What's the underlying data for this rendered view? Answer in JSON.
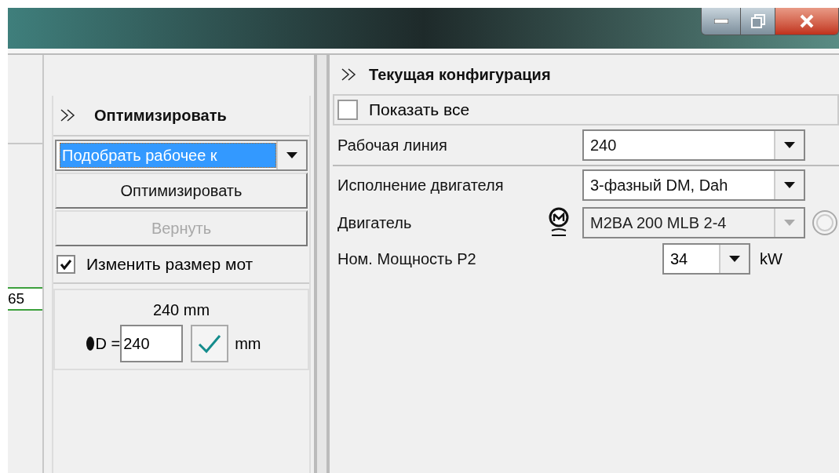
{
  "left_fragment": {
    "value": "65"
  },
  "optimize": {
    "title": "Оптимизировать",
    "mode": {
      "value": "Подобрать рабочее к",
      "selected": true
    },
    "buttons": [
      {
        "label": "Оптимизировать",
        "disabled": false
      },
      {
        "label": "Вернуть",
        "disabled": true
      }
    ],
    "resize": {
      "label": "Изменить размер мот",
      "checked": true
    },
    "diameter": {
      "reading": "240 mm",
      "label": "D =",
      "value": "240",
      "unit": "mm"
    }
  },
  "configuration": {
    "title": "Текущая конфигурация",
    "show_all": {
      "label": "Показать все",
      "checked": false
    },
    "fields": [
      {
        "label": "Рабочая линия",
        "value": "240",
        "disabled": false,
        "motor_icon": false
      },
      {
        "label": "Исполнение двигателя",
        "value": "3-фазный DM, Dah",
        "disabled": false,
        "motor_icon": false
      },
      {
        "label": "Двигатель",
        "value": "M2BA 200 MLB 2-4",
        "disabled": true,
        "motor_icon": true,
        "radio": {
          "selected": false
        }
      }
    ],
    "power": {
      "label": "Ном. Мощность P2",
      "value": "34",
      "unit": "kW"
    }
  }
}
